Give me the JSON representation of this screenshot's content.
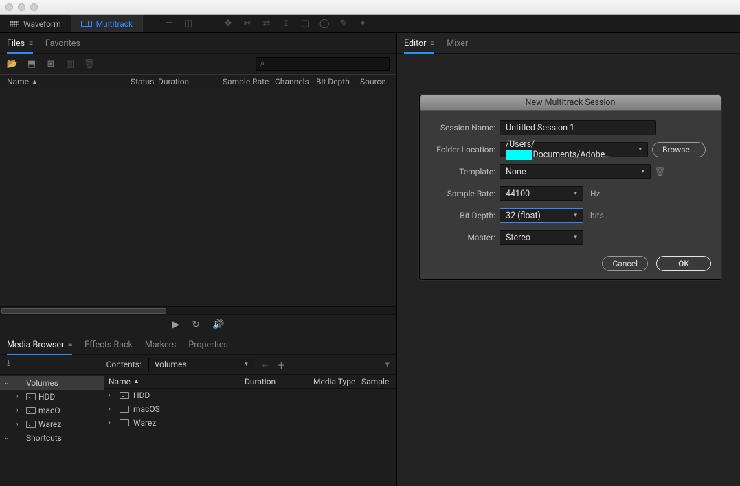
{
  "top": {
    "mode_waveform": "Waveform",
    "mode_multitrack": "Multitrack"
  },
  "files_panel": {
    "tab_files": "Files",
    "tab_favorites": "Favorites",
    "cols": {
      "name": "Name",
      "status": "Status",
      "duration": "Duration",
      "sample_rate": "Sample Rate",
      "channels": "Channels",
      "bit_depth": "Bit Depth",
      "source": "Source"
    },
    "search_icon": "⌕"
  },
  "media_panel": {
    "tab_browser": "Media Browser",
    "tab_effects": "Effects Rack",
    "tab_markers": "Markers",
    "tab_properties": "Properties",
    "contents_label": "Contents:",
    "contents_value": "Volumes",
    "tree": [
      {
        "label": "Volumes",
        "selected": true,
        "expanded": true,
        "indent": false
      },
      {
        "label": "HDD",
        "selected": false,
        "expanded": false,
        "indent": true
      },
      {
        "label": "macO",
        "selected": false,
        "expanded": false,
        "indent": true
      },
      {
        "label": "Warez",
        "selected": false,
        "expanded": false,
        "indent": true
      },
      {
        "label": "Shortcuts",
        "selected": false,
        "expanded": true,
        "indent": false
      }
    ],
    "list_cols": {
      "name": "Name",
      "duration": "Duration",
      "media_type": "Media Type",
      "sample": "Sample"
    },
    "list_rows": [
      {
        "name": "HDD"
      },
      {
        "name": "macOS"
      },
      {
        "name": "Warez"
      }
    ]
  },
  "right_panel": {
    "tab_editor": "Editor",
    "tab_mixer": "Mixer"
  },
  "dialog": {
    "title": "New Multitrack Session",
    "label_session": "Session Name:",
    "value_session": "Untitled Session 1",
    "label_folder": "Folder Location:",
    "value_folder_pre": "/Users/",
    "value_folder_post": "Documents/Adobe…",
    "btn_browse": "Browse…",
    "label_template": "Template:",
    "value_template": "None",
    "label_samplerate": "Sample Rate:",
    "value_samplerate": "44100",
    "unit_hz": "Hz",
    "label_bitdepth": "Bit Depth:",
    "value_bitdepth": "32 (float)",
    "unit_bits": "bits",
    "label_master": "Master:",
    "value_master": "Stereo",
    "btn_cancel": "Cancel",
    "btn_ok": "OK"
  }
}
